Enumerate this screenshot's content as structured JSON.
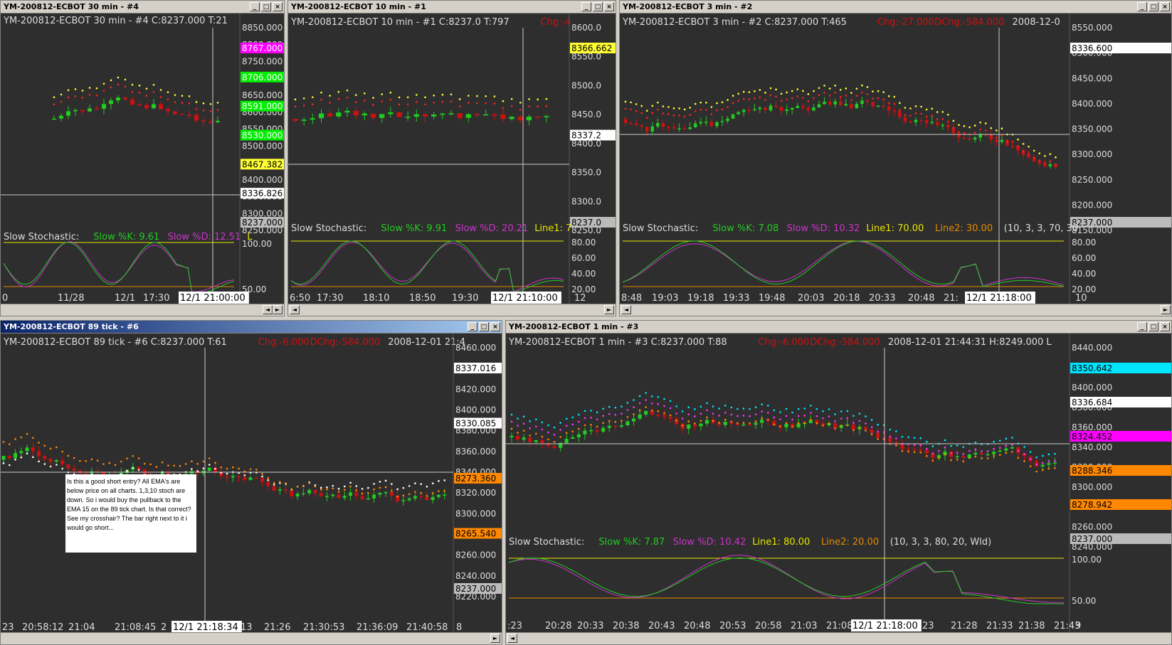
{
  "colors": {
    "bg": "#2e2e2e",
    "up": "#22cc22",
    "down": "#cc1111",
    "k": "#22cc22",
    "d": "#cc33cc",
    "line1": "#e6e600",
    "line2": "#e68a00",
    "grid": "#ffffff"
  },
  "windows": [
    {
      "id": "w4",
      "title": "YM-200812-ECBOT  30 min  - #4",
      "header": [
        "YM-200812-ECBOT  30 min  - #4  C:8237.000  T:21"
      ],
      "stoch": {
        "label": "Slow Stochastic:",
        "k": "Slow %K: 9.61",
        "d": "Slow %D: 12.51",
        "extra": "L"
      },
      "price_ticks": [
        "8850.000",
        "8800.000",
        "8750.000",
        "8700.000",
        "8650.000",
        "8600.000",
        "8550.000",
        "8500.000",
        "8450.000",
        "8400.000",
        "8350.000",
        "8300.000",
        "8250.000"
      ],
      "osc_ticks": [
        "100.00",
        "50.00"
      ],
      "tags": [
        {
          "text": "8767.000",
          "bg": "#ff00ff",
          "fg": "#ffffff"
        },
        {
          "text": "8706.000",
          "bg": "#00ee00",
          "fg": "#ffffff"
        },
        {
          "text": "8591.000",
          "bg": "#00ee00",
          "fg": "#ffffff"
        },
        {
          "text": "8530.000",
          "bg": "#00ee00",
          "fg": "#ffffff"
        },
        {
          "text": "8467.382",
          "bg": "#ffff33",
          "fg": "#000000"
        },
        {
          "text": "8336.826",
          "bg": "#ffffff",
          "fg": "#000000"
        },
        {
          "text": "8237.000",
          "bg": "#bbbbbb",
          "fg": "#000000"
        }
      ],
      "time_ticks": [
        "0",
        "11/28",
        "12/1",
        "17:30"
      ],
      "cursor_time": "12/1 21:00:00"
    },
    {
      "id": "w1",
      "title": "YM-200812-ECBOT  10 min  - #1",
      "header": [
        "YM-200812-ECBOT  10 min  - #1  C:8237.0  T:797  ",
        "Chg:-4"
      ],
      "stoch": {
        "label": "Slow Stochastic:",
        "k": "Slow %K: 9.91",
        "d": "Slow %D: 20.21",
        "extra": "Line1: 7"
      },
      "price_ticks": [
        "8600.0",
        "8550.0",
        "8500.0",
        "8450.0",
        "8400.0",
        "8350.0",
        "8300.0",
        "8250.0"
      ],
      "osc_ticks": [
        "80.00",
        "60.00",
        "40.00",
        "20.00"
      ],
      "tags": [
        {
          "text": "8366.662",
          "bg": "#ffff33",
          "fg": "#000000"
        },
        {
          "text": "8337.2",
          "bg": "#ffffff",
          "fg": "#000000"
        },
        {
          "text": "8237.0",
          "bg": "#bbbbbb",
          "fg": "#000000"
        }
      ],
      "time_ticks": [
        "6:50",
        "17:30",
        "18:10",
        "18:50",
        "19:30",
        "20:10",
        "12"
      ],
      "cursor_time": "12/1 21:10:00"
    },
    {
      "id": "w2",
      "title": "YM-200812-ECBOT  3 min  - #2",
      "header": [
        "YM-200812-ECBOT  3 min  - #2  C:8237.000  T:465  ",
        "Chg:-27.000",
        "  DChg:-584.000",
        "    2008-12-0"
      ],
      "stoch": {
        "label": "Slow Stochastic:",
        "k": "Slow %K: 7.08",
        "d": "Slow %D: 10.32",
        "l1": "Line1: 70.00",
        "l2": "Line2: 30.00",
        "params": "(10, 3, 3, 70, 30"
      },
      "price_ticks": [
        "8550.000",
        "8500.000",
        "8450.000",
        "8400.000",
        "8350.000",
        "8300.000",
        "8250.000",
        "8200.000",
        "8150.000"
      ],
      "osc_ticks": [
        "80.00",
        "60.00",
        "40.00",
        "20.00"
      ],
      "tags": [
        {
          "text": "8336.600",
          "bg": "#ffffff",
          "fg": "#000000"
        },
        {
          "text": "8237.000",
          "bg": "#bbbbbb",
          "fg": "#000000"
        }
      ],
      "time_ticks": [
        "8:48",
        "19:03",
        "19:18",
        "19:33",
        "19:48",
        "20:03",
        "20:18",
        "20:33",
        "20:48",
        "21:",
        "33",
        "10"
      ],
      "cursor_time": "12/1 21:18:00"
    },
    {
      "id": "w6",
      "title": "YM-200812-ECBOT  89 tick - #6",
      "header": [
        "YM-200812-ECBOT  89 tick - #6  C:8237.000  T:61  ",
        "Chg:-6.000",
        "  DChg:-584.000",
        "    2008-12-01  21:4"
      ],
      "price_ticks": [
        "8460.000",
        "8440.000",
        "8420.000",
        "8400.000",
        "8380.000",
        "8360.000",
        "8340.000",
        "8320.000",
        "8300.000",
        "8280.000",
        "8260.000",
        "8240.000",
        "8220.000"
      ],
      "tags": [
        {
          "text": "8337.016",
          "bg": "#ffffff",
          "fg": "#000000"
        },
        {
          "text": "8330.085",
          "bg": "#ffffff",
          "fg": "#000000"
        },
        {
          "text": "8273.360",
          "bg": "#ff8800",
          "fg": "#000000"
        },
        {
          "text": "8265.540",
          "bg": "#ff8800",
          "fg": "#000000"
        },
        {
          "text": "8237.000",
          "bg": "#bbbbbb",
          "fg": "#000000"
        }
      ],
      "time_ticks": [
        "23",
        "20:58:12",
        "21:04",
        "21:08:45",
        "2",
        "13",
        "21:26",
        "21:30:53",
        "21:36:09",
        "21:40:58",
        "8"
      ],
      "cursor_time": "12/1 21:18:34",
      "note": "Is this a good short entry? All EMA's are below price on all charts. 1,3,10 stoch are down. So i would buy the pullback to the EMA 15 on the 89 tick chart. Is that correct? See my crosshair? The bar right next to it i would go short..."
    },
    {
      "id": "w3",
      "title": "YM-200812-ECBOT  1 min  - #3",
      "header": [
        "YM-200812-ECBOT  1 min  - #3  C:8237.000  T:88  ",
        "Chg:-6.000",
        "  DChg:-584.000",
        "    2008-12-01  21:44:31  H:8249.000  L"
      ],
      "stoch": {
        "label": "Slow Stochastic:",
        "k": "Slow %K: 7.87",
        "d": "Slow %D: 10.42",
        "l1": "Line1: 80.00",
        "l2": "Line2: 20.00",
        "params": "(10, 3, 3, 80, 20, Wld)"
      },
      "price_ticks": [
        "8440.000",
        "8420.000",
        "8400.000",
        "8380.000",
        "8360.000",
        "8340.000",
        "8320.000",
        "8300.000",
        "8280.000",
        "8260.000",
        "8240.000"
      ],
      "osc_ticks": [
        "100.00",
        "50.00"
      ],
      "tags": [
        {
          "text": "8350.642",
          "bg": "#00e5ff",
          "fg": "#000000"
        },
        {
          "text": "8336.684",
          "bg": "#ffffff",
          "fg": "#000000"
        },
        {
          "text": "8324.452",
          "bg": "#ff00ff",
          "fg": "#000000"
        },
        {
          "text": "8288.346",
          "bg": "#ff8800",
          "fg": "#000000"
        },
        {
          "text": "8278.942",
          "bg": "#ff8800",
          "fg": "#000000"
        },
        {
          "text": "8237.000",
          "bg": "#bbbbbb",
          "fg": "#000000"
        }
      ],
      "time_ticks": [
        ":23",
        "20:28",
        "20:33",
        "20:38",
        "20:43",
        "20:48",
        "20:53",
        "20:58",
        "21:03",
        "21:08",
        "23",
        "21:28",
        "21:33",
        "21:38",
        "21:43",
        "9"
      ],
      "cursor_time": "12/1 21:18:00"
    }
  ]
}
